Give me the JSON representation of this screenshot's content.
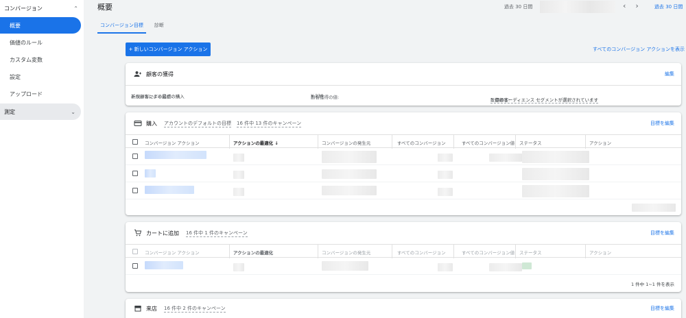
{
  "sidebar": {
    "group_conversion": "コンバージョン",
    "items": [
      {
        "label": "概要",
        "active": true
      },
      {
        "label": "価値のルール",
        "active": false
      },
      {
        "label": "カスタム変数",
        "active": false
      },
      {
        "label": "設定",
        "active": false
      },
      {
        "label": "アップロード",
        "active": false
      }
    ],
    "group_measure": "測定"
  },
  "header": {
    "title": "概要",
    "date_label": "過去 30 日間",
    "date_right": "過去 30 日間"
  },
  "tabs": [
    {
      "label": "コンバージョン目標",
      "active": true
    },
    {
      "label": "診断",
      "active": false
    }
  ],
  "toolbar": {
    "new_action": "+ 新しいコンバージョン アクション",
    "show_all": "すべてのコンバージョン アクションを表示"
  },
  "acquisition_card": {
    "title": "顧客の獲得",
    "edit": "編集",
    "tracking_label": "トラッキングの起点:",
    "tracking_value": "新規顧客による最初の購入",
    "value_label": "顧客獲得の値:",
    "value_value": "¥ 239",
    "existing_label": "既存顧客:",
    "existing_value": "1 個のオーディエンス セグメントが選択されています"
  },
  "purchase_card": {
    "title": "購入",
    "subtitle1": "アカウントのデフォルトの目標",
    "subtitle2": "16 件中 13 件のキャンペーン",
    "edit": "目標を編集",
    "columns": [
      "コンバージョン アクション",
      "アクションの最適化",
      "コンバージョンの発生元",
      "すべてのコンバージョン",
      "すべてのコンバージョン値",
      "ステータス",
      "アクション"
    ]
  },
  "cart_card": {
    "title": "カートに追加",
    "subtitle": "16 件中 1 件のキャンペーン",
    "edit": "目標を編集",
    "columns": [
      "コンバージョン アクション",
      "アクションの最適化",
      "コンバージョンの発生元",
      "すべてのコンバージョン",
      "すべてのコンバージョン値",
      "ステータス",
      "アクション"
    ],
    "pagination": "1 件中 1~1 件を表示"
  },
  "store_card": {
    "title": "来店",
    "subtitle": "16 件中 2 件のキャンペーン",
    "edit": "目標を編集"
  }
}
